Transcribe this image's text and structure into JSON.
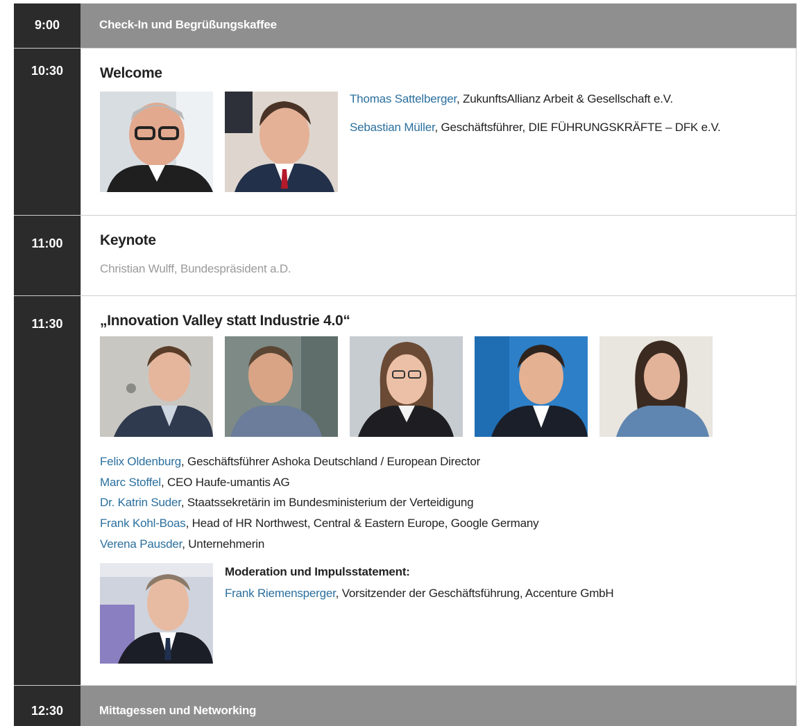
{
  "agenda": {
    "s1": {
      "time": "9:00",
      "band": "Check-In und Begrüßungskaffee"
    },
    "s2": {
      "time": "10:30",
      "title": "Welcome",
      "speakers": [
        {
          "name": "Thomas Sattelberger",
          "role": ", ZukunftsAllianz Arbeit & Gesellschaft e.V."
        },
        {
          "name": "Sebastian Müller",
          "role": ", Geschäftsführer, DIE FÜHRUNGSKRÄFTE – DFK e.V."
        }
      ]
    },
    "s3": {
      "time": "11:00",
      "title": "Keynote",
      "speaker": "Christian Wulff, Bundespräsident a.D."
    },
    "s4": {
      "time": "11:30",
      "title": "„Innovation Valley statt Industrie 4.0“",
      "panel": [
        {
          "name": "Felix Oldenburg",
          "role": ", Geschäftsführer Ashoka Deutschland / European Director"
        },
        {
          "name": "Marc Stoffel",
          "role": ", CEO Haufe-umantis AG"
        },
        {
          "name": "Dr. Katrin Suder",
          "role": ", Staatssekretärin im Bundesministerium der Verteidigung"
        },
        {
          "name": "Frank Kohl-Boas",
          "role": ", Head of HR Northwest, Central & Eastern Europe, Google Germany"
        },
        {
          "name": "Verena Pausder",
          "role": ", Unternehmerin"
        }
      ],
      "moderation_label": "Moderation und Impulsstatement:",
      "moderator": {
        "name": "Frank Riemensperger",
        "role": ", Vorsitzender der Geschäftsführung, Accenture GmbH"
      }
    },
    "s5": {
      "time": "12:30",
      "band": "Mittagessen und Networking"
    }
  },
  "colors": {
    "time_bg": "#2b2b2b",
    "band_bg": "#8f8f8f",
    "link": "#2b6f9e",
    "muted": "#9a9a9a"
  }
}
